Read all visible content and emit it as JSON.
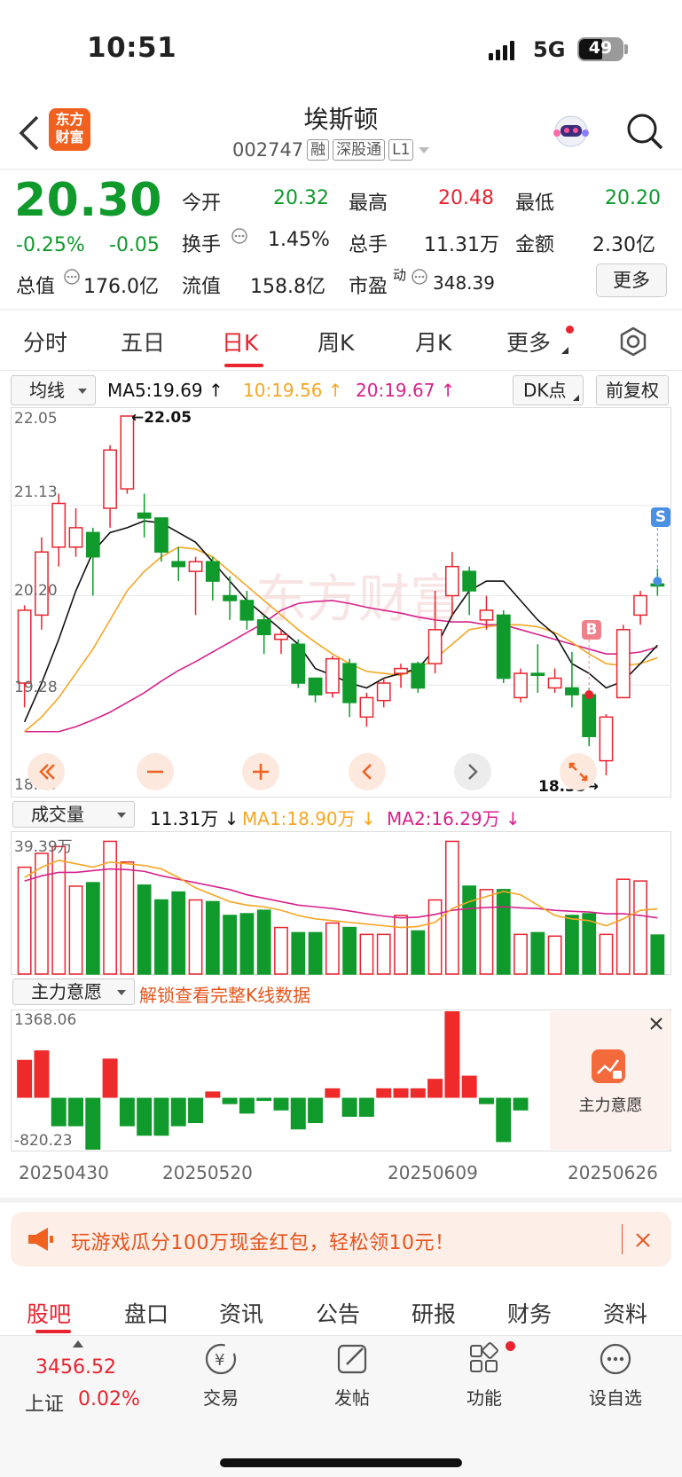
{
  "status": {
    "time": "10:51",
    "network": "5G",
    "battery": "49"
  },
  "header": {
    "logo_line1": "东方",
    "logo_line2": "财富",
    "stock_name": "埃斯顿",
    "stock_code": "002747",
    "tags": [
      "融",
      "深股通",
      "L1"
    ]
  },
  "quote": {
    "price": "20.30",
    "change_pct": "-0.25%",
    "change_abs": "-0.05",
    "rows": [
      [
        {
          "label": "今开",
          "value": "20.32",
          "color": "green"
        },
        {
          "label": "最高",
          "value": "20.48",
          "color": "red"
        },
        {
          "label": "最低",
          "value": "20.20",
          "color": "green"
        }
      ],
      [
        {
          "label": "换手",
          "value": "1.45%",
          "color": "black"
        },
        {
          "label": "总手",
          "value": "11.31万",
          "color": "black"
        },
        {
          "label": "金额",
          "value": "2.30亿",
          "color": "black"
        }
      ],
      [
        {
          "label": "总值",
          "value": "176.0亿",
          "color": "black"
        },
        {
          "label": "流值",
          "value": "158.8亿",
          "color": "black"
        },
        {
          "label": "市盈",
          "value": "348.39",
          "color": "black"
        }
      ]
    ],
    "pe_superscript": "动",
    "more_label": "更多"
  },
  "tabs": {
    "items": [
      "分时",
      "五日",
      "日K",
      "周K",
      "月K",
      "更多"
    ],
    "active": "日K"
  },
  "chart_toolbar": {
    "indicator": "均线",
    "ma5": "MA5:19.69",
    "ma10": "10:19.56",
    "ma20": "20:19.67",
    "dk_label": "DK点",
    "adjust_label": "前复权"
  },
  "kline_axis": {
    "labels": [
      "22.05",
      "21.13",
      "20.20",
      "19.28",
      "18.35"
    ],
    "high_annotation": "←22.05",
    "low_annotation": "18.35→"
  },
  "markers": {
    "buy": "B",
    "sell": "S"
  },
  "volume_toolbar": {
    "indicator": "成交量",
    "vol": "11.31万",
    "ma1": "MA1:18.90万",
    "ma2": "MA2:16.29万",
    "axis_max": "39.39万"
  },
  "flow_toolbar": {
    "indicator": "主力意愿",
    "unlock_text": "解锁查看完整K线数据",
    "axis_max": "1368.06",
    "axis_min": "-820.23",
    "overlay_label": "主力意愿"
  },
  "date_axis": [
    "20250430",
    "20250520",
    "20250609",
    "20250626"
  ],
  "banner": {
    "text": "玩游戏瓜分100万现金红包，轻松领10元！"
  },
  "bottom_tabs": {
    "items": [
      "股吧",
      "盘口",
      "资讯",
      "公告",
      "研报",
      "财务",
      "资料"
    ],
    "active": "股吧"
  },
  "index_info": {
    "value": "3456.52",
    "name": "上证",
    "change": "0.02%"
  },
  "nav": [
    "交易",
    "发帖",
    "功能",
    "设自选"
  ],
  "colors": {
    "up": "#e8242f",
    "down": "#109a2c",
    "ma5": "#111111",
    "ma10": "#f5a623",
    "ma20": "#d6228b",
    "accent": "#f0601e"
  },
  "chart_data": [
    {
      "type": "candlestick",
      "title": "日K",
      "ylim": [
        18.35,
        22.05
      ],
      "candles": [
        {
          "o": 19.3,
          "c": 20.05,
          "h": 20.1,
          "l": 19.05
        },
        {
          "o": 20.0,
          "c": 20.65,
          "h": 20.8,
          "l": 19.85
        },
        {
          "o": 20.7,
          "c": 21.15,
          "h": 21.25,
          "l": 20.5
        },
        {
          "o": 20.7,
          "c": 20.9,
          "h": 21.1,
          "l": 20.6
        },
        {
          "o": 20.85,
          "c": 20.6,
          "h": 20.9,
          "l": 20.2
        },
        {
          "o": 21.1,
          "c": 21.7,
          "h": 21.75,
          "l": 20.9
        },
        {
          "o": 21.3,
          "c": 22.05,
          "h": 22.05,
          "l": 21.25
        },
        {
          "o": 21.05,
          "c": 21.0,
          "h": 21.25,
          "l": 20.8
        },
        {
          "o": 21.0,
          "c": 20.65,
          "h": 21.0,
          "l": 20.55
        },
        {
          "o": 20.55,
          "c": 20.5,
          "h": 20.7,
          "l": 20.35
        },
        {
          "o": 20.45,
          "c": 20.55,
          "h": 20.6,
          "l": 20.0
        },
        {
          "o": 20.55,
          "c": 20.35,
          "h": 20.6,
          "l": 20.15
        },
        {
          "o": 20.2,
          "c": 20.15,
          "h": 20.4,
          "l": 19.95
        },
        {
          "o": 20.15,
          "c": 19.95,
          "h": 20.25,
          "l": 19.85
        },
        {
          "o": 19.95,
          "c": 19.8,
          "h": 20.0,
          "l": 19.6
        },
        {
          "o": 19.75,
          "c": 19.8,
          "h": 19.85,
          "l": 19.6
        },
        {
          "o": 19.7,
          "c": 19.3,
          "h": 19.75,
          "l": 19.25
        },
        {
          "o": 19.35,
          "c": 19.18,
          "h": 19.35,
          "l": 19.1
        },
        {
          "o": 19.2,
          "c": 19.55,
          "h": 19.58,
          "l": 19.15
        },
        {
          "o": 19.5,
          "c": 19.1,
          "h": 19.55,
          "l": 18.95
        },
        {
          "o": 18.95,
          "c": 19.15,
          "h": 19.2,
          "l": 18.85
        },
        {
          "o": 19.12,
          "c": 19.3,
          "h": 19.35,
          "l": 19.05
        },
        {
          "o": 19.4,
          "c": 19.45,
          "h": 19.5,
          "l": 19.25
        },
        {
          "o": 19.5,
          "c": 19.25,
          "h": 19.52,
          "l": 19.2
        },
        {
          "o": 19.5,
          "c": 19.85,
          "h": 20.25,
          "l": 19.4
        },
        {
          "o": 20.2,
          "c": 20.5,
          "h": 20.65,
          "l": 20.0
        },
        {
          "o": 20.45,
          "c": 20.25,
          "h": 20.5,
          "l": 20.0
        },
        {
          "o": 19.95,
          "c": 20.05,
          "h": 20.2,
          "l": 19.85
        },
        {
          "o": 20.0,
          "c": 19.35,
          "h": 20.05,
          "l": 19.3
        },
        {
          "o": 19.15,
          "c": 19.4,
          "h": 19.45,
          "l": 19.1
        },
        {
          "o": 19.4,
          "c": 19.38,
          "h": 19.7,
          "l": 19.2
        },
        {
          "o": 19.25,
          "c": 19.35,
          "h": 19.45,
          "l": 19.2
        },
        {
          "o": 19.25,
          "c": 19.18,
          "h": 19.62,
          "l": 19.05
        },
        {
          "o": 19.18,
          "c": 18.75,
          "h": 19.25,
          "l": 18.65
        },
        {
          "o": 18.5,
          "c": 18.95,
          "h": 18.98,
          "l": 18.35
        },
        {
          "o": 19.15,
          "c": 19.85,
          "h": 19.9,
          "l": 19.15
        },
        {
          "o": 20.0,
          "c": 20.2,
          "h": 20.25,
          "l": 19.9
        },
        {
          "o": 20.32,
          "c": 20.3,
          "h": 20.48,
          "l": 20.2
        }
      ],
      "ma5": [
        18.9,
        19.3,
        19.75,
        20.25,
        20.65,
        20.85,
        20.9,
        20.97,
        20.95,
        20.85,
        20.75,
        20.55,
        20.35,
        20.15,
        20.0,
        19.85,
        19.7,
        19.45,
        19.38,
        19.3,
        19.25,
        19.35,
        19.4,
        19.45,
        19.65,
        20.0,
        20.25,
        20.35,
        20.35,
        20.15,
        19.95,
        19.8,
        19.5,
        19.4,
        19.25,
        19.32,
        19.5,
        19.69
      ],
      "ma10": [
        18.8,
        18.95,
        19.15,
        19.4,
        19.65,
        19.95,
        20.25,
        20.45,
        20.6,
        20.7,
        20.68,
        20.6,
        20.45,
        20.3,
        20.15,
        20.0,
        19.85,
        19.72,
        19.6,
        19.5,
        19.42,
        19.4,
        19.38,
        19.45,
        19.55,
        19.7,
        19.85,
        19.88,
        19.9,
        19.9,
        19.88,
        19.82,
        19.72,
        19.6,
        19.5,
        19.48,
        19.5,
        19.56
      ],
      "ma20": [
        18.8,
        18.8,
        18.8,
        18.85,
        18.92,
        19.0,
        19.1,
        19.2,
        19.32,
        19.43,
        19.52,
        19.62,
        19.72,
        19.82,
        19.92,
        20.05,
        20.12,
        20.14,
        20.15,
        20.12,
        20.08,
        20.05,
        20.02,
        19.98,
        19.95,
        19.93,
        19.93,
        19.9,
        19.9,
        19.85,
        19.8,
        19.75,
        19.7,
        19.65,
        19.6,
        19.6,
        19.62,
        19.67
      ]
    },
    {
      "type": "bar",
      "title": "成交量",
      "ylim": [
        0,
        39.39
      ],
      "values": [
        31,
        35,
        37,
        25.5,
        26.5,
        38.5,
        32.5,
        25.8,
        21.5,
        23.8,
        21.5,
        21.0,
        17.0,
        17.5,
        18.5,
        13.5,
        12.0,
        12.0,
        14.8,
        13.5,
        11.5,
        11.5,
        17.0,
        12.5,
        21.5,
        38.5,
        25.5,
        24.5,
        24.5,
        11.5,
        12.0,
        11.0,
        17.0,
        17.5,
        11.5,
        27.5,
        27.0,
        11.31
      ],
      "ma1": [
        28,
        31,
        33,
        32,
        31,
        32.5,
        32,
        31.5,
        30.5,
        28,
        25,
        23,
        21,
        20,
        19.5,
        18.5,
        17,
        16,
        15.5,
        15,
        14.5,
        14,
        13.5,
        13.8,
        15,
        19,
        21,
        22.5,
        24,
        23,
        20,
        17,
        16,
        15.5,
        14,
        16,
        18.5,
        18.9
      ],
      "ma2": [
        27,
        28.5,
        29.5,
        29.5,
        30,
        30.5,
        30.3,
        29.8,
        28.5,
        27.5,
        26.5,
        25.5,
        24.5,
        23,
        22,
        21,
        20,
        19.5,
        19,
        18.3,
        17.5,
        16.8,
        16.3,
        16.5,
        17.3,
        18.5,
        19,
        19.3,
        19.5,
        19.2,
        19,
        18.5,
        18.2,
        18,
        17.5,
        17.5,
        17,
        16.29
      ]
    },
    {
      "type": "bar",
      "title": "主力意愿",
      "ylim": [
        -820.23,
        1368.06
      ],
      "values": [
        600,
        750,
        -450,
        -450,
        -820.23,
        620,
        -450,
        -600,
        -600,
        -450,
        -400,
        100,
        -100,
        -250,
        -50,
        -200,
        -500,
        -400,
        150,
        -300,
        -300,
        150,
        150,
        150,
        300,
        1368.06,
        350,
        -100,
        -700,
        -200
      ]
    }
  ]
}
